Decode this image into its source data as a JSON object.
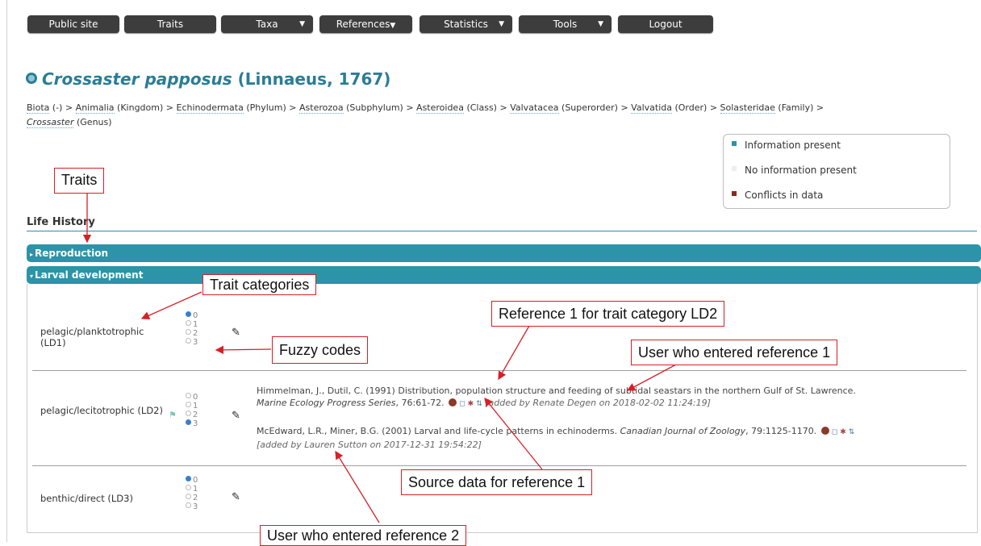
{
  "nav": {
    "items": [
      {
        "label": "Public site",
        "dropdown": false
      },
      {
        "label": "Traits",
        "dropdown": false
      },
      {
        "label": "Taxa",
        "dropdown": true
      },
      {
        "label": "References",
        "dropdown": true
      },
      {
        "label": "Statistics",
        "dropdown": true
      },
      {
        "label": "Tools",
        "dropdown": true
      },
      {
        "label": "Logout",
        "dropdown": false
      }
    ]
  },
  "title": {
    "name": "Crossaster papposus",
    "authority": "(Linnaeus, 1767)"
  },
  "breadcrumb": {
    "items": [
      {
        "label": "Biota",
        "rank": "(-)"
      },
      {
        "label": "Animalia",
        "rank": "(Kingdom)"
      },
      {
        "label": "Echinodermata",
        "rank": "(Phylum)"
      },
      {
        "label": "Asterozoa",
        "rank": "(Subphylum)"
      },
      {
        "label": "Asteroidea",
        "rank": "(Class)"
      },
      {
        "label": "Valvatacea",
        "rank": "(Superorder)"
      },
      {
        "label": "Valvatida",
        "rank": "(Order)"
      },
      {
        "label": "Solasteridae",
        "rank": "(Family)"
      },
      {
        "label": "Crossaster",
        "rank": "(Genus)"
      }
    ],
    "separator": ">"
  },
  "legend": {
    "items": [
      {
        "label": "Information present",
        "color": "#2c93a8"
      },
      {
        "label": "No information present",
        "color": "#eeeeee"
      },
      {
        "label": "Conflicts in data",
        "color": "#8a2a1f"
      }
    ]
  },
  "section": {
    "title": "Life History"
  },
  "bars": {
    "reproduction": {
      "label": "Reproduction",
      "arrow": "▸"
    },
    "larval": {
      "label": "Larval development",
      "arrow": "▾"
    }
  },
  "traits": [
    {
      "label": "pelagic/planktotrophic (LD1)",
      "codes": [
        "0",
        "1",
        "2",
        "3"
      ],
      "selected": 0
    },
    {
      "label": "pelagic/lecitotrophic (LD2)",
      "codes": [
        "0",
        "1",
        "2",
        "3"
      ],
      "selected": 3
    },
    {
      "label": "benthic/direct (LD3)",
      "codes": [
        "0",
        "1",
        "2",
        "3"
      ],
      "selected": 0
    }
  ],
  "references": {
    "ref1": {
      "authors": "Himmelman, J., Dutil, C. (1991) Distribution, population structure and feeding of subtidal seastars in the northern Gulf of St. Lawrence.",
      "journal": "Marine Ecology Progress Series",
      "pages": ", 76:61-72.",
      "added": "[added by Renate Degen on 2018-02-02 11:24:19]"
    },
    "ref2": {
      "authors": "McEdward, L.R., Miner, B.G. (2001) Larval and life-cycle patterns in echinoderms.",
      "journal": "Canadian Journal of Zoology",
      "pages": ", 79:1125-1170.",
      "added": "[added by Lauren Sutton on 2017-12-31 19:54:22]"
    }
  },
  "annotations": {
    "traits": "Traits",
    "trait_categories": "Trait categories",
    "fuzzy_codes": "Fuzzy codes",
    "ref1_category": "Reference 1 for trait category LD2",
    "user_ref1": "User who entered reference 1",
    "source_ref1": "Source data for reference 1",
    "user_ref2": "User who entered reference 2"
  },
  "colors": {
    "accent": "#2c93a8",
    "callout_border": "#d81f26",
    "nav": "#3d3d3d"
  }
}
